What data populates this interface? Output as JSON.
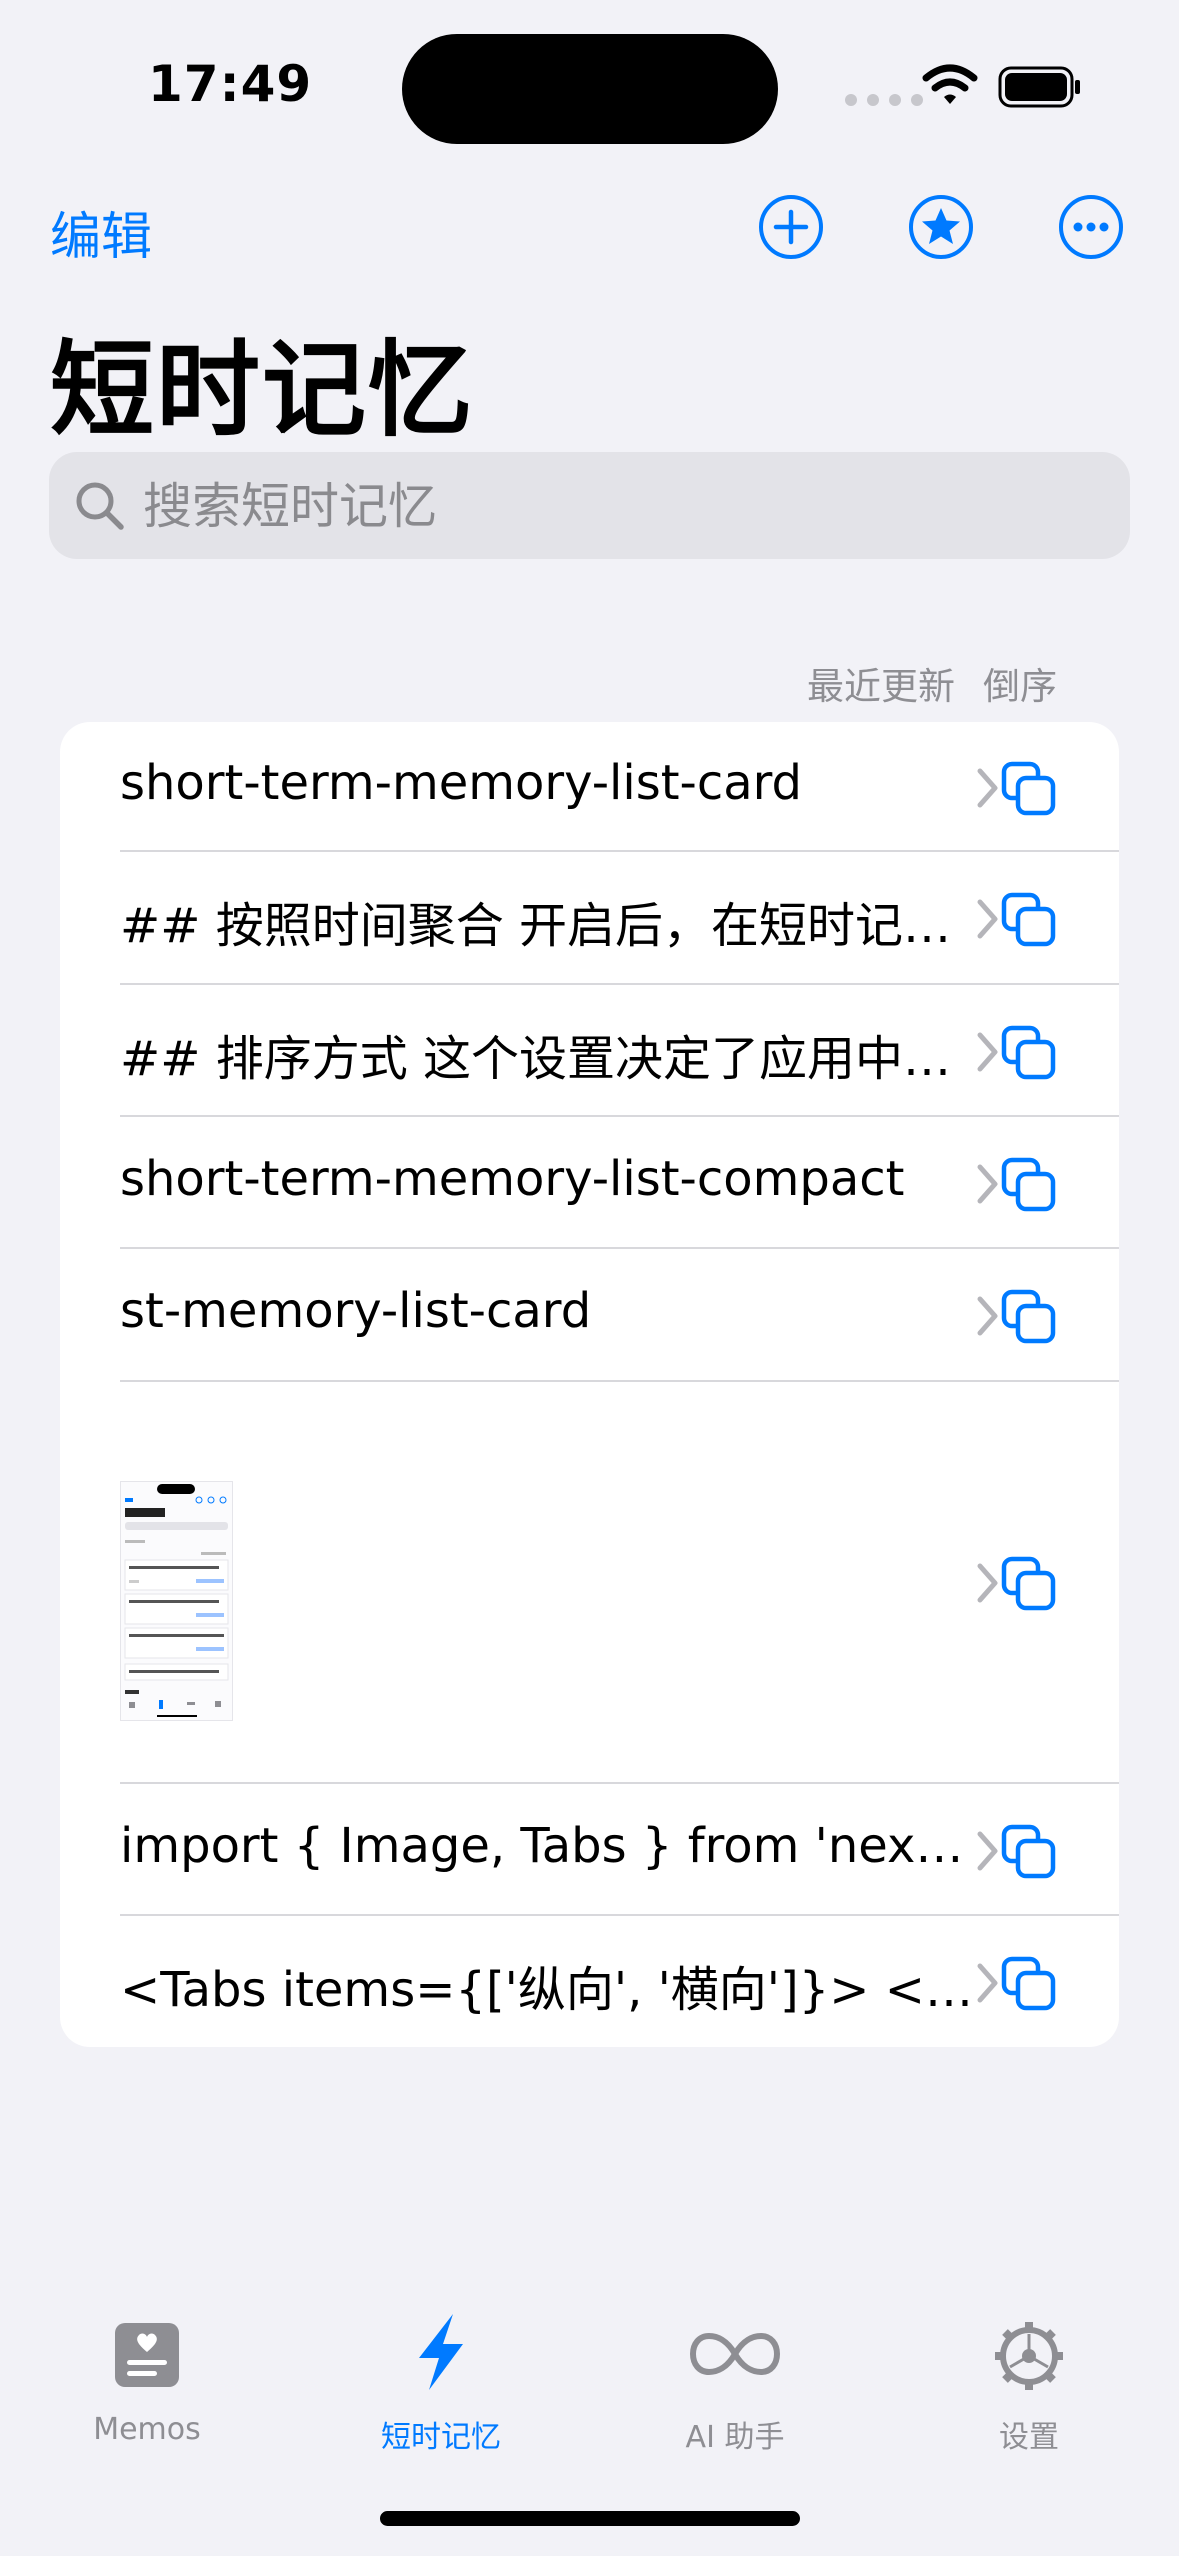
{
  "status": {
    "time": "17:49"
  },
  "nav": {
    "edit_label": "编辑",
    "title": "短时记忆"
  },
  "search": {
    "placeholder": "搜索短时记忆"
  },
  "sort": {
    "field": "最近更新",
    "order": "倒序"
  },
  "items": [
    {
      "text": "short-term-memory-list-card"
    },
    {
      "text": "## 按照时间聚合  开启后，在短时记忆列表中按时间分组显示"
    },
    {
      "text": "## 排序方式  这个设置决定了应用中列表的排序方式"
    },
    {
      "text": "short-term-memory-list-compact"
    },
    {
      "text": "st-memory-list-card"
    },
    {
      "text": "",
      "thumbnail": "image"
    },
    {
      "text": "import { Image, Tabs } from 'nextra/components'"
    },
    {
      "text": "<Tabs items={['纵向', '横向']}>   <Tabs.Tab>"
    }
  ],
  "tabbar": {
    "tabs": [
      {
        "label": "Memos",
        "icon": "memo-card-icon",
        "active": false
      },
      {
        "label": "短时记忆",
        "icon": "lightning-bolt-icon",
        "active": true
      },
      {
        "label": "AI 助手",
        "icon": "infinity-icon",
        "active": false
      },
      {
        "label": "设置",
        "icon": "gear-icon",
        "active": false
      }
    ]
  },
  "colors": {
    "accent": "#007aff",
    "background": "#f2f2f7",
    "inactive": "#8e8e93"
  }
}
